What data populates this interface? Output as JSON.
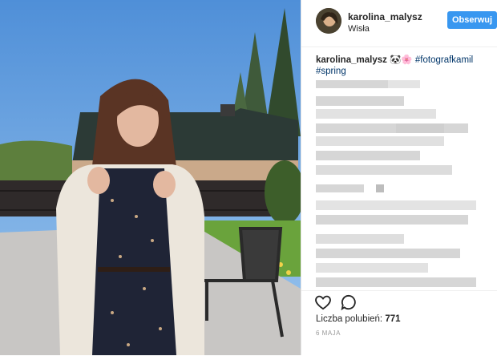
{
  "post": {
    "username": "karolina_malysz",
    "location": "Wisła",
    "follow_label": "Obserwuj",
    "caption_emoji": "🐼🌸",
    "caption_tags": [
      "#fotografkamil",
      "#spring"
    ],
    "likes_label": "Liczba polubień:",
    "likes_count": "771",
    "date": "6 MAJA"
  },
  "icons": {
    "like": "heart-icon",
    "comment": "speech-bubble-icon"
  },
  "colors": {
    "follow_button": "#3897f0",
    "hashtag": "#003569",
    "text": "#262626",
    "muted": "#999999"
  }
}
